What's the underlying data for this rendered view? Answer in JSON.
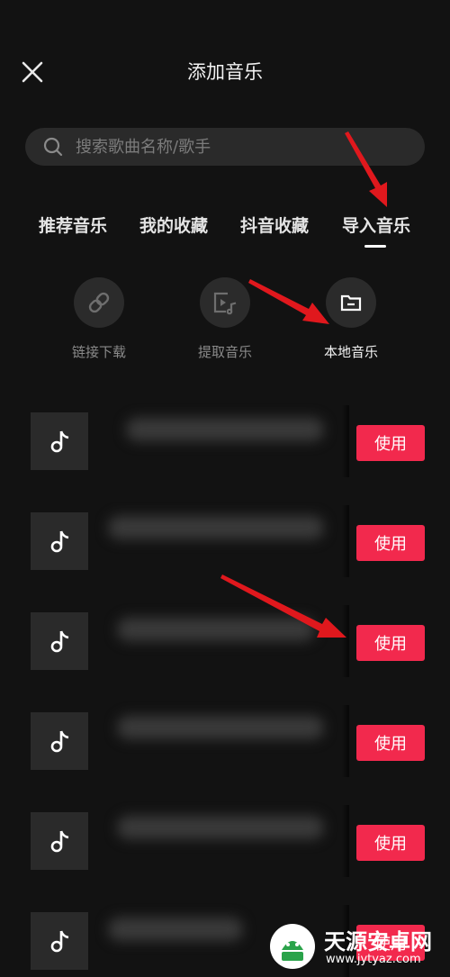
{
  "colors": {
    "background": "#121212",
    "accent": "#f2294d",
    "annotation_arrow": "#e0181d"
  },
  "header": {
    "title": "添加音乐",
    "close_icon": "close-icon"
  },
  "search": {
    "placeholder": "搜索歌曲名称/歌手",
    "icon": "search-icon"
  },
  "tabs": [
    {
      "label": "推荐音乐",
      "selected": false
    },
    {
      "label": "我的收藏",
      "selected": false
    },
    {
      "label": "抖音收藏",
      "selected": false
    },
    {
      "label": "导入音乐",
      "selected": true
    }
  ],
  "tools": [
    {
      "label": "链接下载",
      "icon": "link-icon",
      "active": false
    },
    {
      "label": "提取音乐",
      "icon": "video-music-icon",
      "active": false
    },
    {
      "label": "本地音乐",
      "icon": "folder-icon",
      "active": true
    }
  ],
  "songs": {
    "use_label": "使用",
    "thumb_icon": "music-note-icon",
    "titles_blurred": true,
    "count_visible": 6
  },
  "watermark": {
    "title": "天源安卓网",
    "url": "www.jytyaz.com"
  }
}
